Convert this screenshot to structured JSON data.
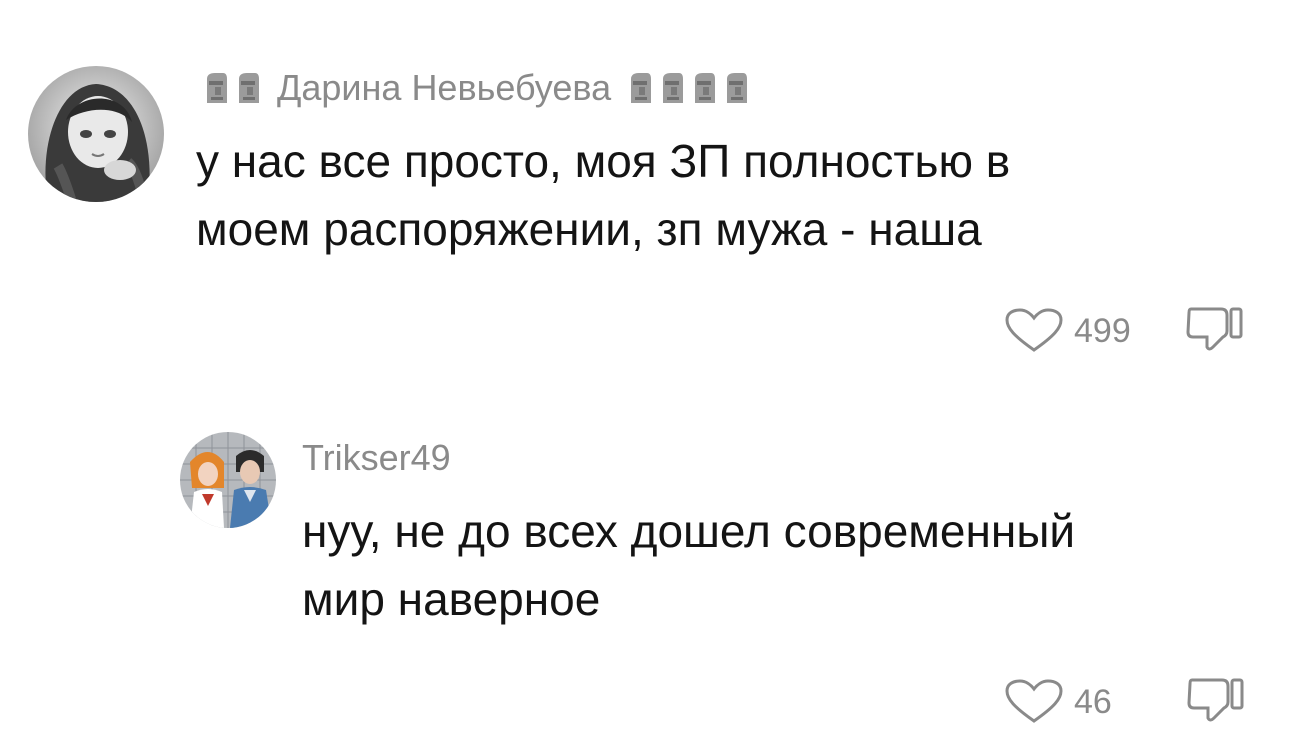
{
  "comments": [
    {
      "username": "Дарина Невьебуева",
      "username_prefix_icons": [
        "moai-icon",
        "moai-icon"
      ],
      "username_suffix_icons": [
        "moai-icon",
        "moai-icon",
        "moai-icon",
        "moai-icon"
      ],
      "text": "у нас все просто, моя ЗП полностью в\nмоем распоряжении, зп мужа - наша",
      "likes": "499",
      "avatar": "anime-girl-avatar"
    },
    {
      "username": "Trikser49",
      "text": "нуу, не до всех дошел современный\nмир наверное",
      "likes": "46",
      "avatar": "two-characters-avatar"
    }
  ],
  "icons": {
    "like": "heart-outline-icon",
    "dislike": "thumbs-down-outline-icon"
  },
  "colors": {
    "background": "#ffffff",
    "text": "#141414",
    "muted": "#8a8a8a"
  }
}
